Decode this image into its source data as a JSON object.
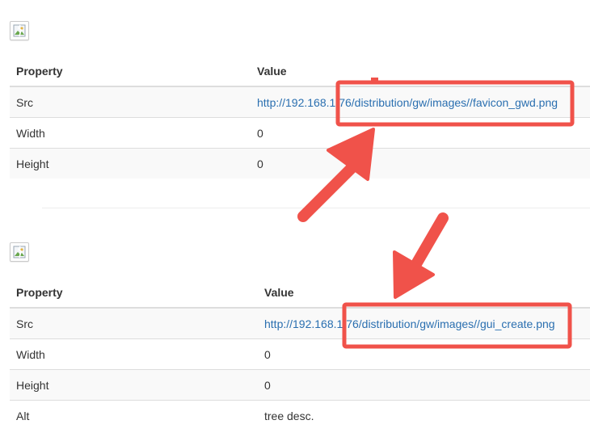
{
  "section1": {
    "headers": {
      "property": "Property",
      "value": "Value"
    },
    "rows": [
      {
        "property": "Src",
        "value": "http://192.168.1.76/distribution/gw/images//favicon_gwd.png",
        "is_link": true
      },
      {
        "property": "Width",
        "value": "0",
        "is_link": false
      },
      {
        "property": "Height",
        "value": "0",
        "is_link": false
      }
    ]
  },
  "section2": {
    "headers": {
      "property": "Property",
      "value": "Value"
    },
    "rows": [
      {
        "property": "Src",
        "value": "http://192.168.1.76/distribution/gw/images//gui_create.png",
        "is_link": true
      },
      {
        "property": "Width",
        "value": "0",
        "is_link": false
      },
      {
        "property": "Height",
        "value": "0",
        "is_link": false
      },
      {
        "property": "Alt",
        "value": "tree desc.",
        "is_link": false
      }
    ]
  },
  "annotation_color": "#f0524a",
  "link_color": "#2a6fb0"
}
